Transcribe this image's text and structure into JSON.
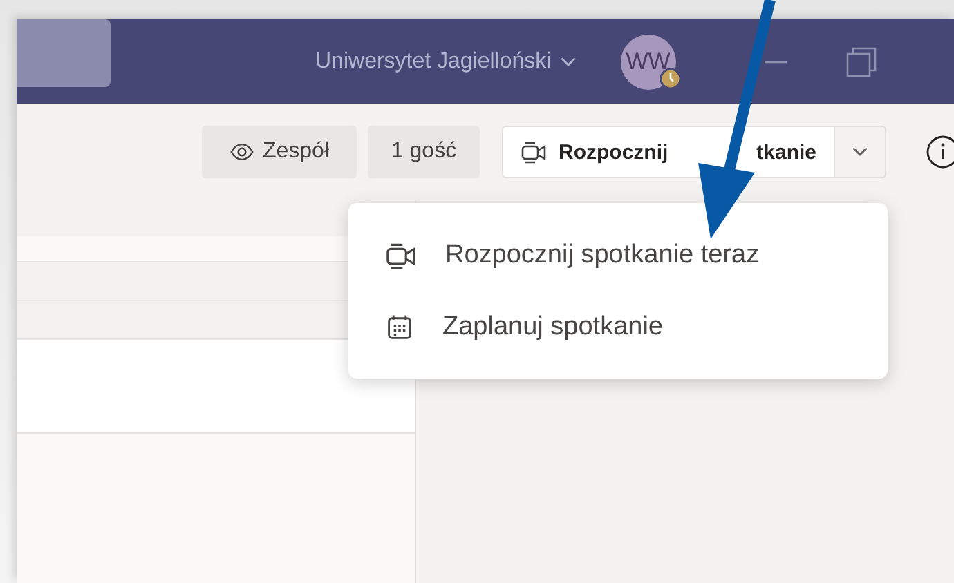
{
  "title_bar": {
    "organization": "Uniwersytet Jagielloński",
    "avatar": {
      "initials": "WW"
    }
  },
  "toolbar": {
    "buttons": [
      {
        "label": "Zespół",
        "kind": "eye"
      },
      {
        "label": "1 gość",
        "kind": "plain"
      }
    ],
    "meet_button": {
      "label_start": "Rozpocznij",
      "label_end": "tkanie",
      "expanded": true
    }
  },
  "menu": {
    "items": [
      {
        "label": "Rozpocznij spotkanie teraz",
        "kind": "video"
      },
      {
        "label": "Zaplanuj spotkanie",
        "kind": "calendar"
      }
    ]
  }
}
